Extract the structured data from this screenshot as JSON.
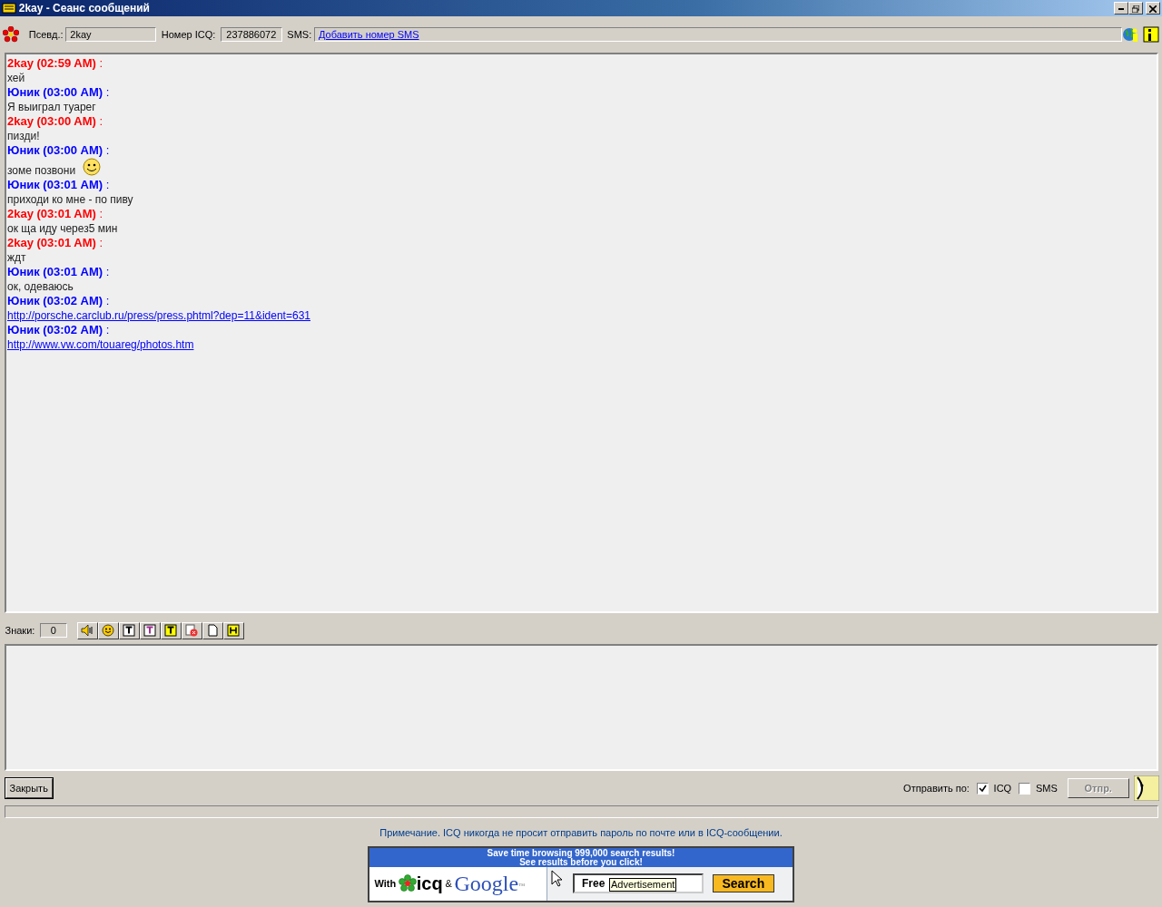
{
  "window": {
    "title": "2kay - Сеанс сообщений"
  },
  "info_bar": {
    "nick_label": "Псевд.:",
    "nick": "2kay",
    "icq_label": "Номер ICQ:",
    "icq": "237886072",
    "sms_label": "SMS:",
    "sms_link": "Добавить номер SMS"
  },
  "messages": [
    {
      "header": "**2kay (02:59 AM)** :",
      "color": "#ff0000",
      "kind": "text",
      "body": "хей"
    },
    {
      "header": "**Юник (03:00 AM)** :",
      "color": "#0000ff",
      "kind": "text",
      "body": "Я выиграл туарег"
    },
    {
      "header": "**2kay (03:00 AM)** :",
      "color": "#ff0000",
      "kind": "text",
      "body": "пизди!"
    },
    {
      "header": "**Юник (03:00 AM)** :",
      "color": "#0000ff",
      "kind": "text",
      "body": "зоме позвони",
      "emoticon": true
    },
    {
      "header": "**Юник (03:01 AM)** :",
      "color": "#0000ff",
      "kind": "text",
      "body": "приходи ко мне - по пиву"
    },
    {
      "header": "**2kay (03:01 AM)** :",
      "color": "#ff0000",
      "kind": "text",
      "body": "ок ща иду через5 мин"
    },
    {
      "header": "**2kay (03:01 AM)** :",
      "color": "#ff0000",
      "kind": "text",
      "body": "ждт"
    },
    {
      "header": "**Юник (03:01 AM)** :",
      "color": "#0000ff",
      "kind": "text",
      "body": "ок, одеваюсь"
    },
    {
      "header": "**Юник (03:02 AM)** :",
      "color": "#0000ff",
      "kind": "link",
      "body": "http://porsche.carclub.ru/press/press.phtml?dep=11&ident=631"
    },
    {
      "header": "**Юник (03:02 AM)** :",
      "color": "#0000ff",
      "kind": "link",
      "body": "http://www.vw.com/touareg/photos.htm"
    }
  ],
  "compose": {
    "count_label": "Знаки:",
    "count": "0",
    "tools": [
      {
        "kind": "sound"
      },
      {
        "kind": "smiley"
      },
      {
        "kind": "text"
      },
      {
        "kind": "text-color"
      },
      {
        "kind": "text-bg"
      },
      {
        "kind": "clear"
      },
      {
        "kind": "page"
      },
      {
        "kind": "html"
      }
    ]
  },
  "bottom": {
    "close": "Закрыть",
    "send_via": "Отправить по:",
    "options": [
      {
        "label": "ICQ",
        "checked": true
      },
      {
        "label": "SMS",
        "checked": false
      }
    ],
    "send": {
      "label": "Отпр.",
      "disabled": true
    }
  },
  "note": "Примечание. ICQ никогда не просит отправить пароль по почте или в ICQ-сообщении.",
  "ad": {
    "headline": "Save time browsing 999,000 search results!",
    "subline": "See results before you click!",
    "with": "With",
    "icq": "icq",
    "and": "&",
    "google": "Google",
    "tm": "™",
    "field": "Free",
    "tooltip": "Advertisement",
    "button": "Search"
  }
}
